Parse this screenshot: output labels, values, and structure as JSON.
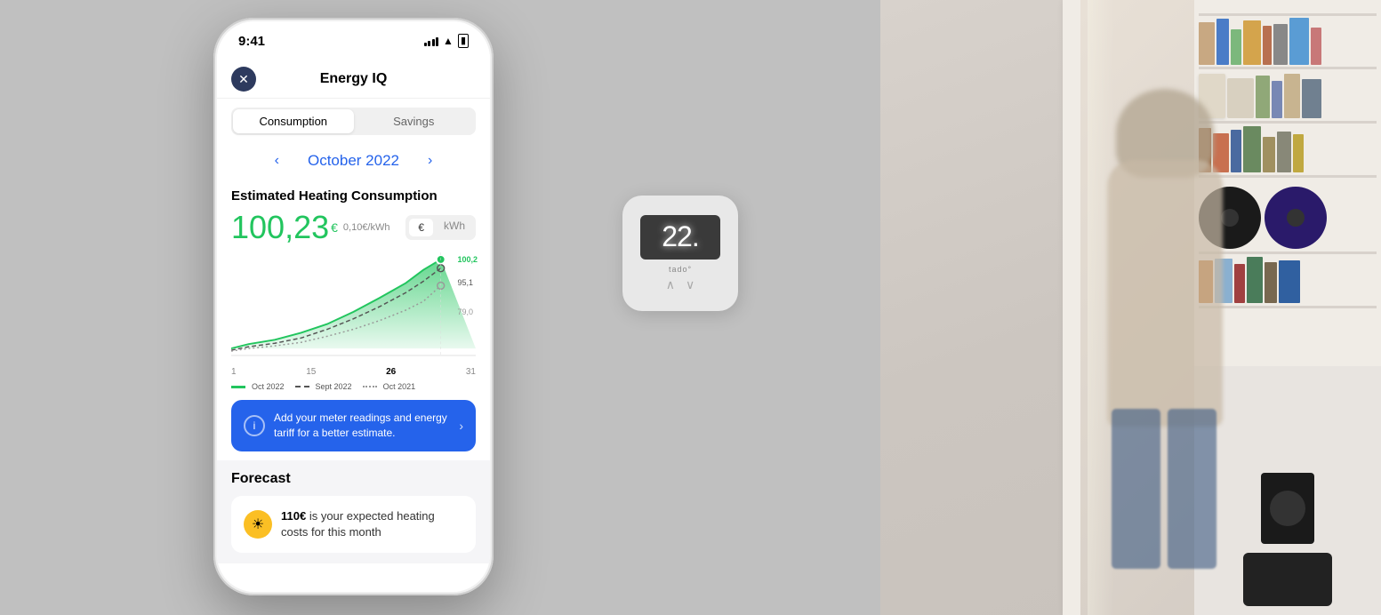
{
  "background": {
    "left_color": "#c0c0c0",
    "right_color": "#d8d0c8"
  },
  "thermostat": {
    "temperature": "22.",
    "brand": "tado°",
    "up_arrow": "∧",
    "down_arrow": "∨"
  },
  "phone": {
    "status_bar": {
      "time": "9:41",
      "signal": "●●●●",
      "wifi": "WiFi",
      "battery": "Battery"
    },
    "header": {
      "close_icon": "✕",
      "title": "Energy IQ"
    },
    "tabs": {
      "consumption": "Consumption",
      "savings": "Savings"
    },
    "month_nav": {
      "prev_arrow": "‹",
      "month": "October 2022",
      "next_arrow": "›"
    },
    "consumption": {
      "label": "Estimated Heating Consumption",
      "main_value": "100,23",
      "currency_symbol": "€",
      "rate": "0,10€/kWh",
      "unit_eur": "€",
      "unit_kwh": "kWh"
    },
    "chart": {
      "x_labels": [
        "1",
        "15",
        "26",
        "31"
      ],
      "x_label_bold_index": 2,
      "legend": [
        {
          "type": "solid_line",
          "color": "#22c55e",
          "label": "Oct 2022"
        },
        {
          "type": "dashed",
          "color": "#666",
          "label": "Sept 2022"
        },
        {
          "type": "dotted",
          "color": "#999",
          "label": "Oct 2021"
        }
      ],
      "right_values": [
        "100,2",
        "95,1",
        "79,0"
      ]
    },
    "info_banner": {
      "icon": "i",
      "text": "Add your meter readings and energy tariff for a better estimate.",
      "arrow": "›"
    },
    "forecast": {
      "title": "Forecast",
      "icon": "●",
      "text_prefix": "",
      "amount": "110€",
      "text_suffix": " is your expected heating costs for this month"
    }
  }
}
